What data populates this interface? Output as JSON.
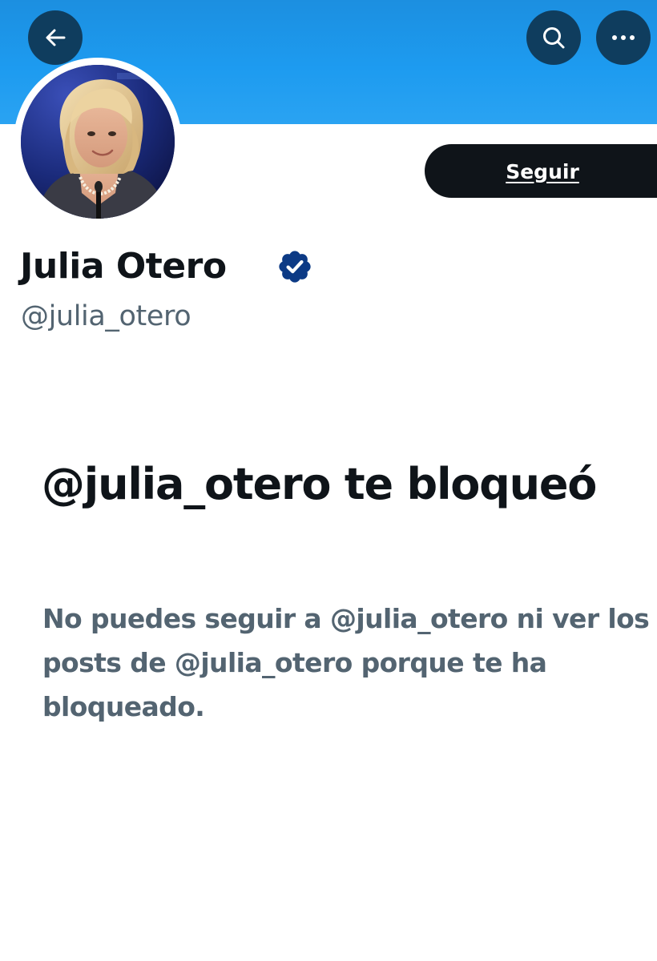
{
  "header": {
    "back_icon": "arrow-left-icon",
    "search_icon": "search-icon",
    "more_icon": "more-horizontal-icon",
    "banner_color": "#1d9bf0"
  },
  "profile": {
    "display_name": "Julia Otero",
    "handle": "@julia_otero",
    "verified": true,
    "verified_icon": "verified-badge-icon",
    "verified_color": "#0c3a85",
    "follow_label": "Seguir"
  },
  "blocked": {
    "title": "@julia_otero te bloqueó",
    "description": "No puedes seguir a @julia_otero ni ver los posts de @julia_otero porque te ha bloqueado."
  }
}
